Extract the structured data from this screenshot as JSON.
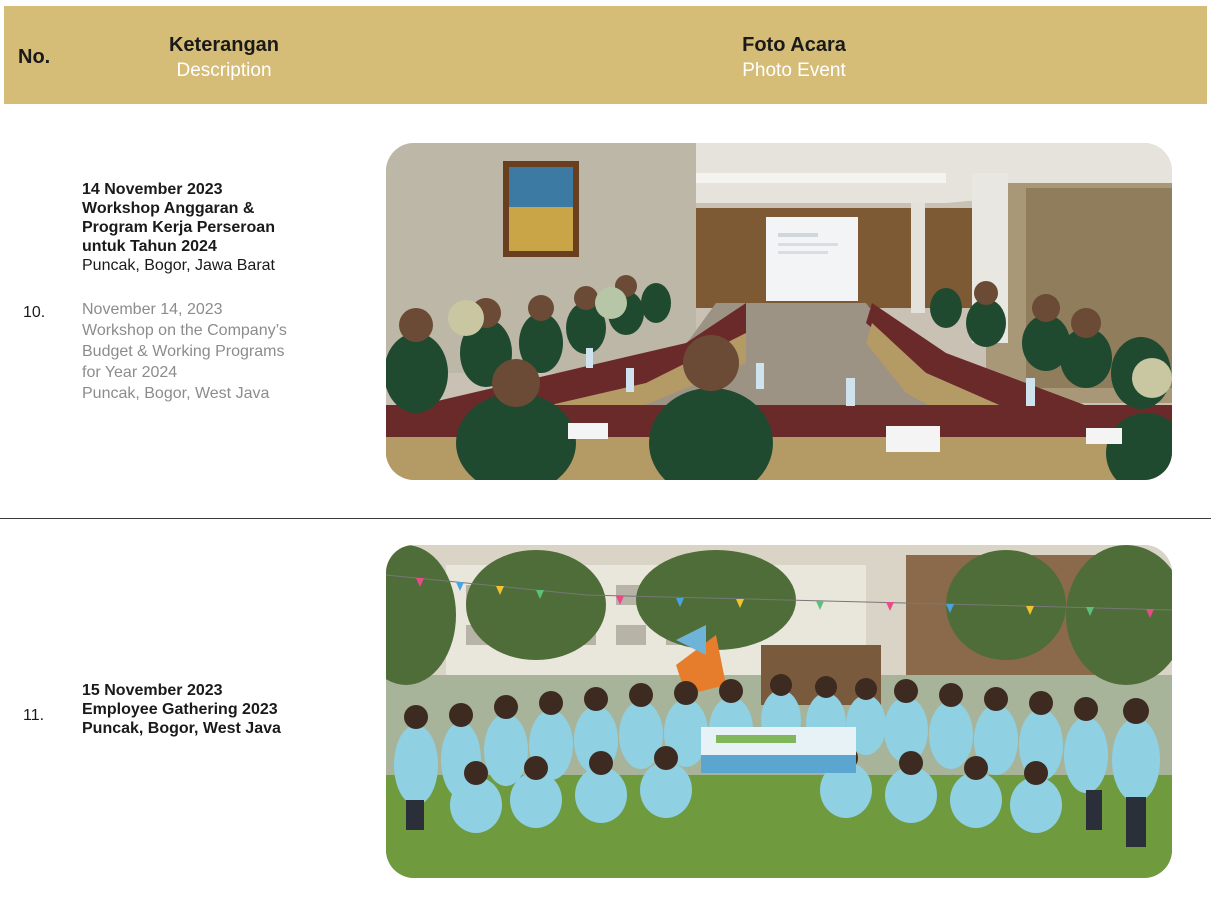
{
  "header": {
    "no_label": "No.",
    "desc_label": "Keterangan",
    "desc_label_en": "Description",
    "photo_label": "Foto Acara",
    "photo_label_en": "Photo Event"
  },
  "rows": [
    {
      "no": "10.",
      "title_id_1": "14 November 2023",
      "title_id_2": "Workshop Anggaran &",
      "title_id_3": "Program Kerja Perseroan",
      "title_id_4": "untuk Tahun 2024",
      "location_id": "Puncak, Bogor, Jawa Barat",
      "en_1": "November 14, 2023",
      "en_2": "Workshop on the Company’s",
      "en_3": "Budget & Working Programs",
      "en_4": "for Year 2024",
      "en_5": "Puncak, Bogor, West Java"
    },
    {
      "no": "11.",
      "line_1": "15 November 2023",
      "line_2": "Employee Gathering 2023",
      "line_3": "Puncak, Bogor, West Java"
    }
  ],
  "colors": {
    "header_bg": "#d6bd77",
    "header_subtext": "#ffffff",
    "secondary_text": "#8c8c8c"
  }
}
